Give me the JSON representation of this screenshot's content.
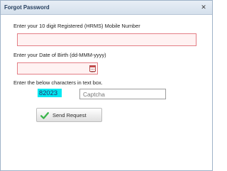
{
  "dialog": {
    "title": "Forgot Password",
    "close_label": "✕"
  },
  "form": {
    "mobile_label": "Enter your 10 digit Registered (HRMS) Mobile Number",
    "dob_label": "Enter your Date of Birth (dd-MMM-yyyy)",
    "captcha_label": "Enter the below characters in text box.",
    "captcha_code": "82023",
    "captcha_placeholder": "Captcha",
    "submit_label": "Send Request"
  },
  "colors": {
    "required_field_border": "#e37f86",
    "required_field_fill": "#fff2f2",
    "captcha_background": "#00e9f2",
    "success_check": "#39b54a"
  },
  "icons": {
    "close": "close-icon",
    "calendar": "calendar-icon",
    "submit": "checkmark-icon"
  }
}
